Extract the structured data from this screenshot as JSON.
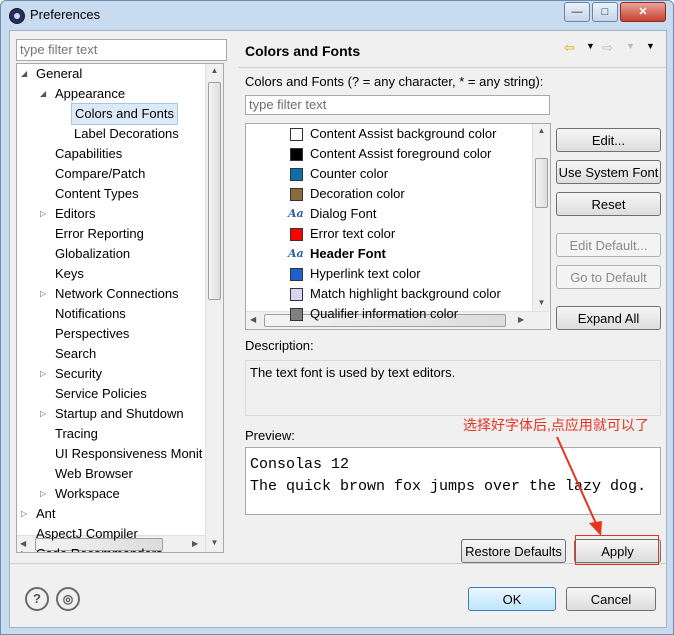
{
  "window": {
    "title": "Preferences",
    "controls": {
      "minimize": "—",
      "maximize": "□",
      "close": "✕"
    }
  },
  "sidebar": {
    "filter_placeholder": "type filter text",
    "items": [
      {
        "label": "General",
        "level": 0,
        "expander": "expanded"
      },
      {
        "label": "Appearance",
        "level": 1,
        "expander": "expanded"
      },
      {
        "label": "Colors and Fonts",
        "level": 2,
        "expander": "none",
        "selected": true
      },
      {
        "label": "Label Decorations",
        "level": 2,
        "expander": "none"
      },
      {
        "label": "Capabilities",
        "level": 1,
        "expander": "none"
      },
      {
        "label": "Compare/Patch",
        "level": 1,
        "expander": "none"
      },
      {
        "label": "Content Types",
        "level": 1,
        "expander": "none"
      },
      {
        "label": "Editors",
        "level": 1,
        "expander": "collapsed"
      },
      {
        "label": "Error Reporting",
        "level": 1,
        "expander": "none"
      },
      {
        "label": "Globalization",
        "level": 1,
        "expander": "none"
      },
      {
        "label": "Keys",
        "level": 1,
        "expander": "none"
      },
      {
        "label": "Network Connections",
        "level": 1,
        "expander": "collapsed"
      },
      {
        "label": "Notifications",
        "level": 1,
        "expander": "none"
      },
      {
        "label": "Perspectives",
        "level": 1,
        "expander": "none"
      },
      {
        "label": "Search",
        "level": 1,
        "expander": "none"
      },
      {
        "label": "Security",
        "level": 1,
        "expander": "collapsed"
      },
      {
        "label": "Service Policies",
        "level": 1,
        "expander": "none"
      },
      {
        "label": "Startup and Shutdown",
        "level": 1,
        "expander": "collapsed"
      },
      {
        "label": "Tracing",
        "level": 1,
        "expander": "none"
      },
      {
        "label": "UI Responsiveness Monit",
        "level": 1,
        "expander": "none"
      },
      {
        "label": "Web Browser",
        "level": 1,
        "expander": "none"
      },
      {
        "label": "Workspace",
        "level": 1,
        "expander": "collapsed"
      },
      {
        "label": "Ant",
        "level": 0,
        "expander": "collapsed"
      },
      {
        "label": "AspectJ Compiler",
        "level": 0,
        "expander": "none"
      },
      {
        "label": "Code Recommenders",
        "level": 0,
        "expander": "collapsed"
      }
    ]
  },
  "main": {
    "title": "Colors and Fonts",
    "list_label": "Colors and Fonts (? = any character, * = any string):",
    "list_filter_placeholder": "type filter text",
    "color_items": [
      {
        "label": "Content Assist background color",
        "kind": "color",
        "color": "#ffffff"
      },
      {
        "label": "Content Assist foreground color",
        "kind": "color",
        "color": "#000000"
      },
      {
        "label": "Counter color",
        "kind": "color",
        "color": "#0b6fa8"
      },
      {
        "label": "Decoration color",
        "kind": "color",
        "color": "#8b6a3e"
      },
      {
        "label": "Dialog Font",
        "kind": "font"
      },
      {
        "label": "Error text color",
        "kind": "color",
        "color": "#ff0000"
      },
      {
        "label": "Header Font",
        "kind": "font",
        "bold": true
      },
      {
        "label": "Hyperlink text color",
        "kind": "color",
        "color": "#1f5fd1"
      },
      {
        "label": "Match highlight background color",
        "kind": "color",
        "color": "#d8d3f0"
      },
      {
        "label": "Qualifier information color",
        "kind": "color",
        "color": "#808080"
      }
    ],
    "buttons": {
      "edit": "Edit...",
      "use_system_font": "Use System Font",
      "reset": "Reset",
      "edit_default": "Edit Default...",
      "go_to_default": "Go to Default",
      "expand_all": "Expand All"
    },
    "description_label": "Description:",
    "description_text": "The text font is used by text editors.",
    "preview_label": "Preview:",
    "preview_lines": [
      "Consolas 12",
      "The quick brown fox jumps over the lazy dog."
    ],
    "restore_defaults": "Restore Defaults",
    "apply": "Apply"
  },
  "annotation": {
    "text": "选择好字体后,点应用就可以了",
    "color": "#e8331f"
  },
  "footer": {
    "ok": "OK",
    "cancel": "Cancel",
    "help_icon": "?",
    "import_icon": "◎"
  }
}
